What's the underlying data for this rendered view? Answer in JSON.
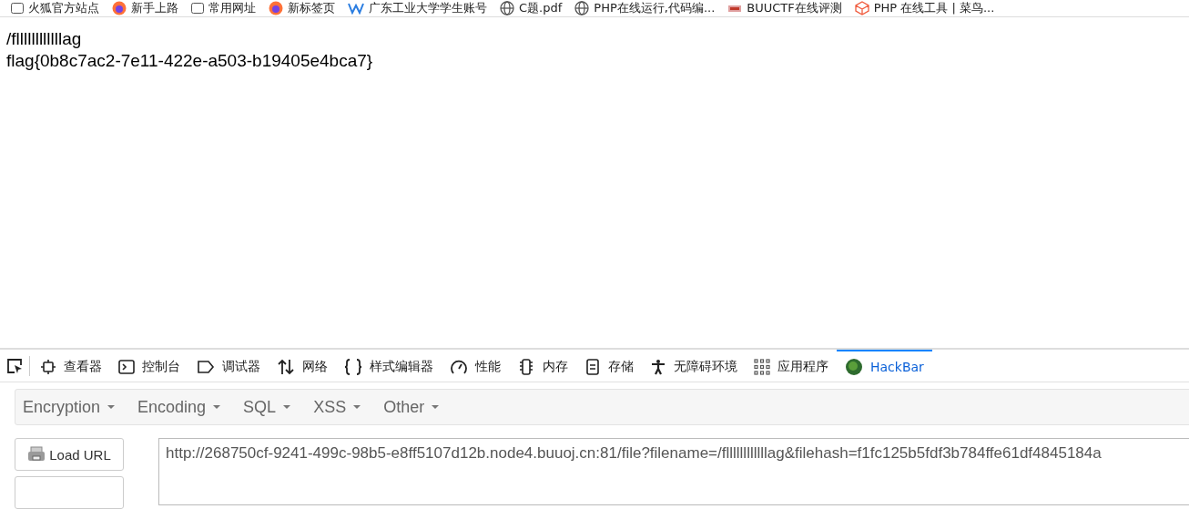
{
  "bookmarks": [
    {
      "label": "火狐官方站点",
      "kind": "folder"
    },
    {
      "label": "新手上路",
      "kind": "firefox"
    },
    {
      "label": "常用网址",
      "kind": "folder"
    },
    {
      "label": "新标签页",
      "kind": "firefox"
    },
    {
      "label": "广东工业大学学生账号",
      "kind": "wave"
    },
    {
      "label": "C题.pdf",
      "kind": "globe"
    },
    {
      "label": "PHP在线运行,代码编...",
      "kind": "globe"
    },
    {
      "label": "BUUCTF在线评测",
      "kind": "ctf"
    },
    {
      "label": "PHP 在线工具 | 菜鸟...",
      "kind": "cube"
    }
  ],
  "page": {
    "lines": [
      "/fllllllllllllag",
      "flag{0b8c7ac2-7e11-422e-a503-b19405e4bca7}"
    ]
  },
  "devtools": {
    "tabs": [
      {
        "label": "查看器",
        "kind": "inspector",
        "selected": false
      },
      {
        "label": "控制台",
        "kind": "console",
        "selected": false
      },
      {
        "label": "调试器",
        "kind": "debugger",
        "selected": false
      },
      {
        "label": "网络",
        "kind": "network",
        "selected": false
      },
      {
        "label": "样式编辑器",
        "kind": "style",
        "selected": false
      },
      {
        "label": "性能",
        "kind": "performance",
        "selected": false
      },
      {
        "label": "内存",
        "kind": "memory",
        "selected": false
      },
      {
        "label": "存储",
        "kind": "storage",
        "selected": false
      },
      {
        "label": "无障碍环境",
        "kind": "accessibility",
        "selected": false
      },
      {
        "label": "应用程序",
        "kind": "application",
        "selected": false
      },
      {
        "label": "HackBar",
        "kind": "hackbar",
        "selected": true
      }
    ]
  },
  "hackbar": {
    "menus": [
      "Encryption",
      "Encoding",
      "SQL",
      "XSS",
      "Other"
    ],
    "load_button": "Load URL",
    "url": "http://268750cf-9241-499c-98b5-e8ff5107d12b.node4.buuoj.cn:81/file?filename=/fllllllllllllag&filehash=f1fc125b5fdf3b784ffe61df4845184a"
  }
}
